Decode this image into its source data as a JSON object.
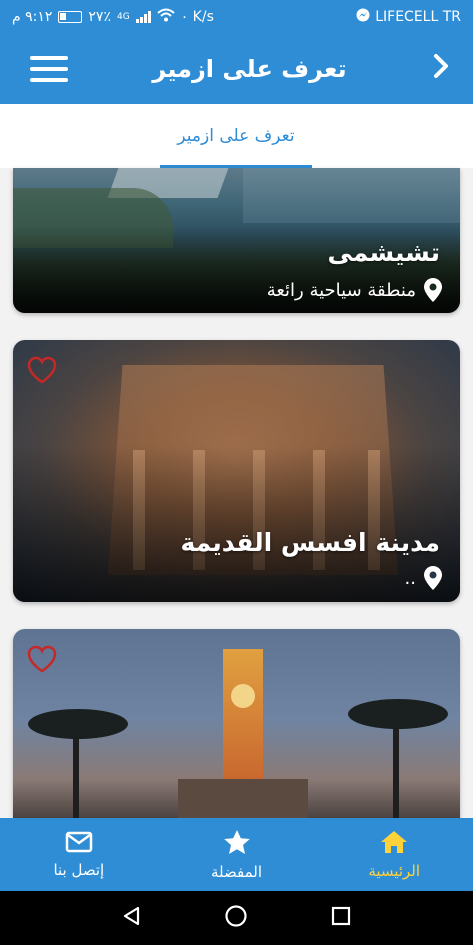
{
  "status_bar": {
    "carrier": "LIFECELL TR",
    "time": "٩:١٢ م",
    "battery": "٢٧٪",
    "network": "4G",
    "speed": "٠ K/s"
  },
  "app_bar": {
    "title": "تعرف على ازمير"
  },
  "tabs": [
    {
      "label": "تعرف على ازمير",
      "active": true
    }
  ],
  "cards": [
    {
      "title": "تشيشمى",
      "subtitle": "منطقة سياحية رائعة",
      "favorite_visible": false
    },
    {
      "title": "مدينة افسس القديمة",
      "subtitle": "..",
      "favorite_visible": true
    },
    {
      "title": "",
      "subtitle": "",
      "favorite_visible": true
    }
  ],
  "bottom_nav": {
    "items": [
      {
        "label": "إتصل بنا",
        "icon": "mail-icon",
        "active": false
      },
      {
        "label": "المفضلة",
        "icon": "star-icon",
        "active": false
      },
      {
        "label": "الرئيسية",
        "icon": "home-icon",
        "active": true
      }
    ]
  },
  "colors": {
    "primary": "#2f8dd6",
    "active_nav": "#ffd23a",
    "favorite": "#c62828"
  }
}
